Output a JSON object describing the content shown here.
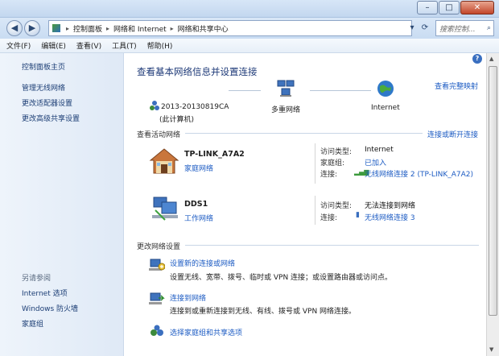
{
  "window": {
    "minimize_symbol": "–",
    "maximize_symbol": "□",
    "close_symbol": "✕"
  },
  "address": {
    "crumbs": [
      "控制面板",
      "网络和 Internet",
      "网络和共享中心"
    ],
    "search_placeholder": "搜索控制..."
  },
  "menu": [
    "文件(F)",
    "编辑(E)",
    "查看(V)",
    "工具(T)",
    "帮助(H)"
  ],
  "sidebar": {
    "items": [
      "控制面板主页",
      "管理无线网络",
      "更改适配器设置",
      "更改高级共享设置"
    ],
    "see_also_title": "另请参阅",
    "see_also": [
      "Internet 选项",
      "Windows 防火墙",
      "家庭组"
    ]
  },
  "main": {
    "heading": "查看基本网络信息并设置连接",
    "full_map_link": "查看完整映射",
    "topology": {
      "computer_name": "2013-20130819CA",
      "computer_sub": "(此计算机)",
      "middle": "多重网络",
      "right": "Internet"
    },
    "active_networks_title": "查看活动网络",
    "connect_disconnect_link": "连接或断开连接",
    "networks": [
      {
        "name": "TP-LINK_A7A2",
        "type_link": "家庭网络",
        "rows": [
          {
            "label": "访问类型:",
            "value": "Internet",
            "is_link": false
          },
          {
            "label": "家庭组:",
            "value": "已加入",
            "is_link": true
          },
          {
            "label": "连接:",
            "value": "无线网络连接 2 (TP-LINK_A7A2)",
            "is_link": true
          }
        ]
      },
      {
        "name": "DDS1",
        "type_link": "工作网络",
        "rows": [
          {
            "label": "访问类型:",
            "value": "无法连接到网络",
            "is_link": false
          },
          {
            "label": "连接:",
            "value": "无线网络连接 3",
            "is_link": true
          }
        ]
      }
    ],
    "change_settings_title": "更改网络设置",
    "tasks": [
      {
        "title": "设置新的连接或网络",
        "desc": "设置无线、宽带、拨号、临时或 VPN 连接；或设置路由器或访问点。"
      },
      {
        "title": "连接到网络",
        "desc": "连接到或重新连接到无线、有线、拨号或 VPN 网络连接。"
      },
      {
        "title": "选择家庭组和共享选项",
        "desc": ""
      }
    ]
  },
  "help_symbol": "?"
}
